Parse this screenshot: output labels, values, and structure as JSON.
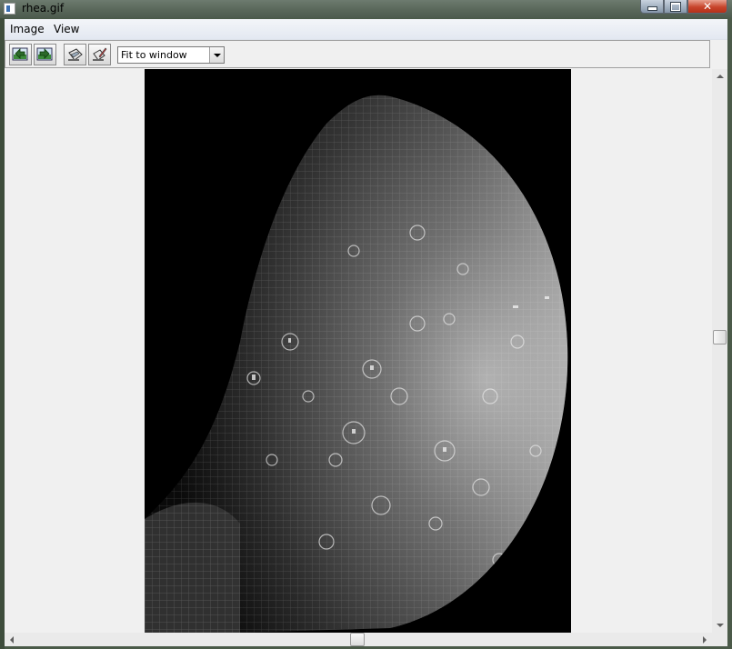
{
  "window": {
    "title": "rhea.gif",
    "close_glyph": "✕"
  },
  "menu": {
    "items": [
      "Image",
      "View"
    ]
  },
  "toolbar": {
    "buttons": [
      {
        "icon": "open-image-icon"
      },
      {
        "icon": "next-image-icon"
      },
      {
        "icon": "save-icon"
      },
      {
        "icon": "edit-icon"
      }
    ],
    "zoom_value": "Fit to window"
  },
  "colors": {
    "titlebar": "#5d6b5f",
    "workspace": "#f0f0f0",
    "image_background": "#000000",
    "moon_surface": "#9a9a9a"
  }
}
